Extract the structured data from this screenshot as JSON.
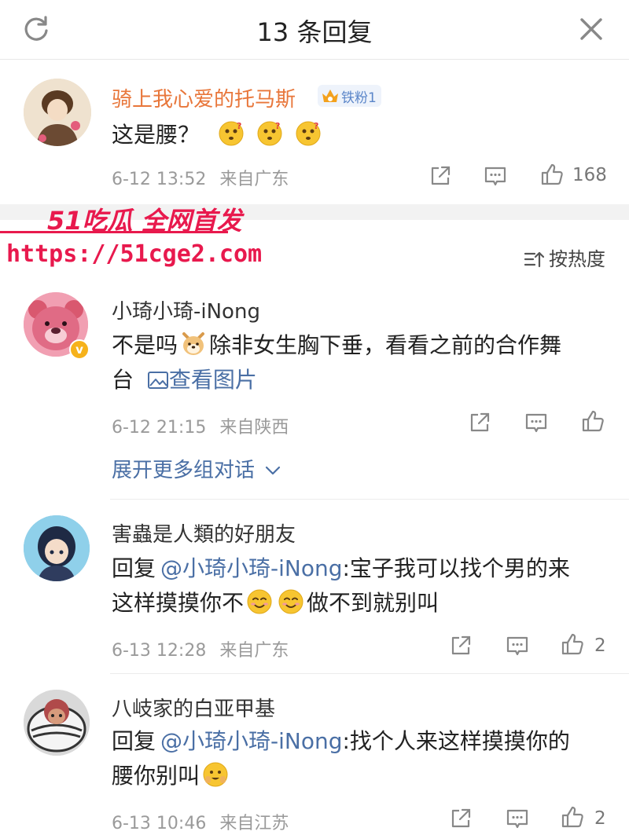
{
  "header": {
    "title": "13 条回复",
    "refresh_icon": "refresh-icon",
    "close_icon": "close-icon"
  },
  "comment1": {
    "username": "骑上我心爱的托马斯",
    "fan_badge": "铁粉1",
    "text": "这是腰？",
    "emoji": "thinking-face-icon",
    "time": "6-12 13:52",
    "location": "来自广东",
    "likes": "168"
  },
  "watermark": {
    "logo": "51吃瓜 全网首发",
    "url": "https://51cge2.com"
  },
  "sort": {
    "label": "按热度"
  },
  "comment2": {
    "username": "小琦小琦-iNong",
    "text_part1": "不是吗",
    "text_part2": "除非女生胸下垂，看看之前的合作舞",
    "text_part3": "台",
    "view_image": "查看图片",
    "time": "6-12 21:15",
    "location": "来自陕西"
  },
  "expand": {
    "label": "展开更多组对话"
  },
  "reply1": {
    "username": "害蟲是人類的好朋友",
    "prefix": "回复",
    "mention": "@小琦小琦-iNong",
    "text_part1": ":宝子我可以找个男的来",
    "text_part2": "这样摸摸你不",
    "text_part3": "做不到就别叫",
    "time": "6-13 12:28",
    "location": "来自广东",
    "likes": "2"
  },
  "reply2": {
    "username": "八岐家的白亚甲基",
    "prefix": "回复",
    "mention": "@小琦小琦-iNong",
    "text_part1": ":找个人来这样摸摸你的",
    "text_part2": "腰你别叫",
    "time": "6-13 10:46",
    "location": "来自江苏",
    "likes": "2"
  },
  "colors": {
    "accent_orange": "#e8763a",
    "link_blue": "#4a6fa5",
    "watermark_red": "#e8194d"
  }
}
